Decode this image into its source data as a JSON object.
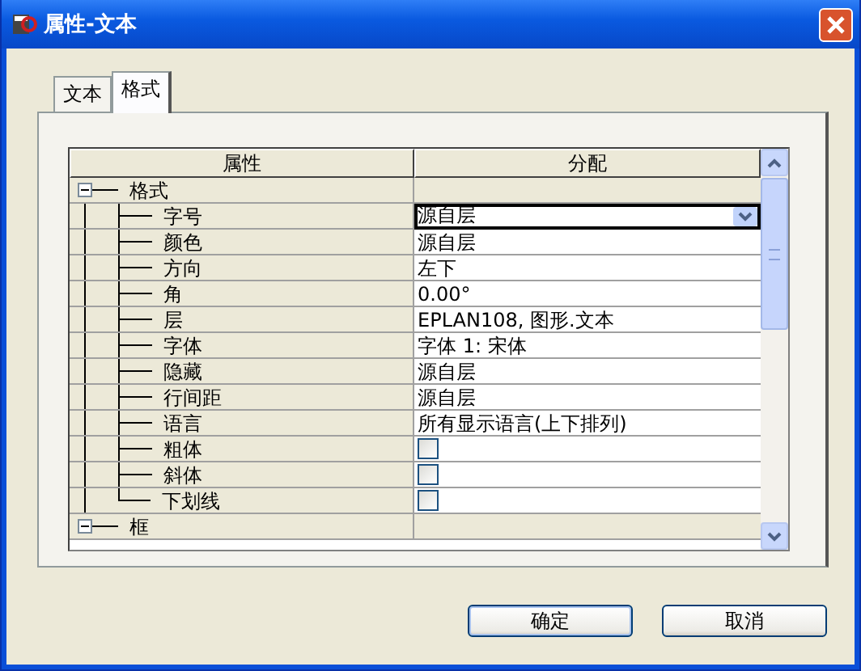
{
  "window": {
    "title": "属性-文本"
  },
  "tabs": [
    {
      "label": "文本",
      "selected": false
    },
    {
      "label": "格式",
      "selected": true
    }
  ],
  "table": {
    "columns": [
      "属性",
      "分配"
    ],
    "groups": [
      {
        "label": "格式",
        "expanded": true,
        "children": [
          {
            "label": "字号",
            "kind": "dropdown",
            "value": "源自层",
            "focused": true
          },
          {
            "label": "颜色",
            "kind": "text",
            "value": "源自层"
          },
          {
            "label": "方向",
            "kind": "text",
            "value": "左下"
          },
          {
            "label": "角",
            "kind": "text",
            "value": "0.00°"
          },
          {
            "label": "层",
            "kind": "text",
            "value": "EPLAN108, 图形.文本"
          },
          {
            "label": "字体",
            "kind": "text",
            "value": "字体 1: 宋体"
          },
          {
            "label": "隐藏",
            "kind": "text",
            "value": "源自层"
          },
          {
            "label": "行间距",
            "kind": "text",
            "value": "源自层"
          },
          {
            "label": "语言",
            "kind": "text",
            "value": "所有显示语言(上下排列)"
          },
          {
            "label": "粗体",
            "kind": "checkbox",
            "checked": false
          },
          {
            "label": "斜体",
            "kind": "checkbox",
            "checked": false
          },
          {
            "label": "下划线",
            "kind": "checkbox",
            "checked": false
          }
        ]
      },
      {
        "label": "框",
        "expanded": true
      }
    ]
  },
  "buttons": [
    "确定",
    "取消"
  ]
}
